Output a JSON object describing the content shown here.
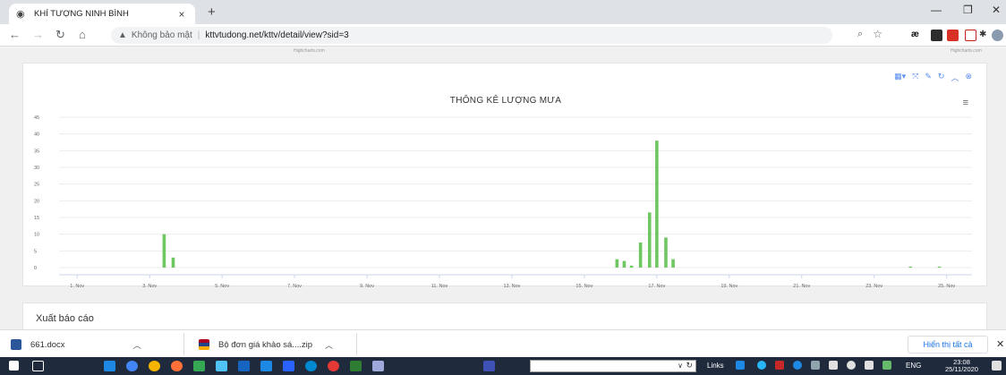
{
  "browser": {
    "tab_title": "KHÍ TƯỢNG NINH BÌNH",
    "security_label": "Không bảo mật",
    "url": "kttvtudong.net/kttv/detail/view?sid=3"
  },
  "page": {
    "credit_text": "Highcharts.com",
    "report_title": "Xuất báo cáo"
  },
  "chart_data": {
    "type": "bar",
    "title": "THÔNG KÊ LƯỢNG MƯA",
    "xlabel": "",
    "ylabel": "",
    "ylim": [
      0,
      45
    ],
    "yticks": [
      "0",
      "5",
      "10",
      "15",
      "20",
      "25",
      "30",
      "35",
      "40",
      "45"
    ],
    "xticks": [
      "1. Nov",
      "3. Nov",
      "5. Nov",
      "7. Nov",
      "9. Nov",
      "11. Nov",
      "13. Nov",
      "15. Nov",
      "17. Nov",
      "19. Nov",
      "21. Nov",
      "23. Nov",
      "25. Nov"
    ],
    "xrange": [
      0.5,
      25.7
    ],
    "color": "#6fc761",
    "grid": true,
    "legend": "none",
    "bars": [
      {
        "x": 3.4,
        "y": 10
      },
      {
        "x": 3.65,
        "y": 3
      },
      {
        "x": 15.9,
        "y": 2.5
      },
      {
        "x": 16.1,
        "y": 2
      },
      {
        "x": 16.3,
        "y": 0.6
      },
      {
        "x": 16.55,
        "y": 7.5
      },
      {
        "x": 16.8,
        "y": 16.5
      },
      {
        "x": 17.0,
        "y": 38
      },
      {
        "x": 17.25,
        "y": 9
      },
      {
        "x": 17.45,
        "y": 2.5
      },
      {
        "x": 24.0,
        "y": 0.3
      },
      {
        "x": 24.8,
        "y": 0.3
      }
    ]
  },
  "chart_tools": [
    "table-icon",
    "fullscreen-icon",
    "pin-icon",
    "refresh-icon",
    "collapse-icon",
    "close-icon"
  ],
  "downloads": {
    "items": [
      "661.docx",
      "Bộ đơn giá khảo sá....zip"
    ],
    "show_all": "Hiển thị tất cả"
  },
  "taskbar": {
    "links": "Links",
    "lang": "ENG",
    "time": "23:08",
    "date": "25/11/2020"
  }
}
